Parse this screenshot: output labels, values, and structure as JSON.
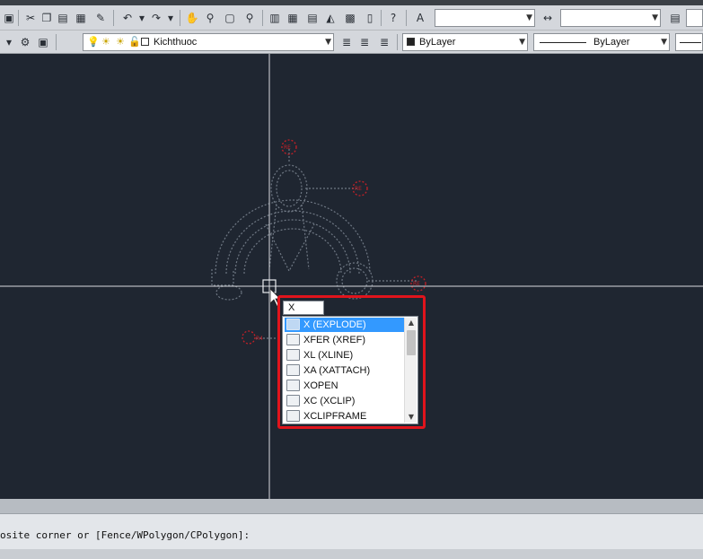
{
  "toolbar": {
    "layer_name": "Kichthuoc",
    "color_value": "ByLayer",
    "linetype_value": "ByLayer"
  },
  "autocomplete": {
    "input_value": "X",
    "items": [
      {
        "label": "X (EXPLODE)",
        "icon": "explode-icon",
        "selected": true
      },
      {
        "label": "XFER (XREF)",
        "icon": "xref-icon",
        "selected": false
      },
      {
        "label": "XL (XLINE)",
        "icon": "xline-icon",
        "selected": false
      },
      {
        "label": "XA (XATTACH)",
        "icon": "xattach-icon",
        "selected": false
      },
      {
        "label": "XOPEN",
        "icon": "xopen-icon",
        "selected": false
      },
      {
        "label": "XC (XCLIP)",
        "icon": "xclip-icon",
        "selected": false
      },
      {
        "label": "XCLIPFRAME",
        "icon": "xclipframe-icon",
        "selected": false
      }
    ]
  },
  "command_line": {
    "prompt": "osite corner or [Fence/WPolygon/CPolygon]:"
  },
  "colors": {
    "canvas_bg": "#1f2631",
    "crosshair": "#d8dbe0",
    "selection_highlight": "#e0141c",
    "list_selected": "#3399ff"
  }
}
